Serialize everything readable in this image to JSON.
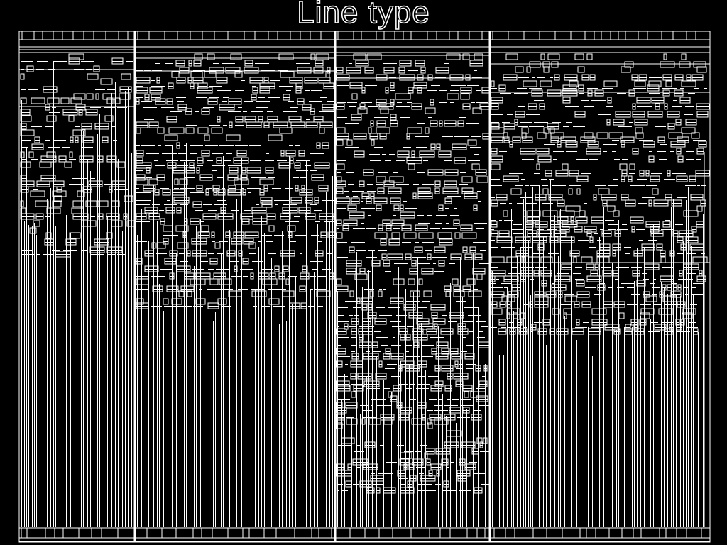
{
  "title": "Line type",
  "colors": {
    "background": "#000000",
    "line": "#ffffff"
  }
}
